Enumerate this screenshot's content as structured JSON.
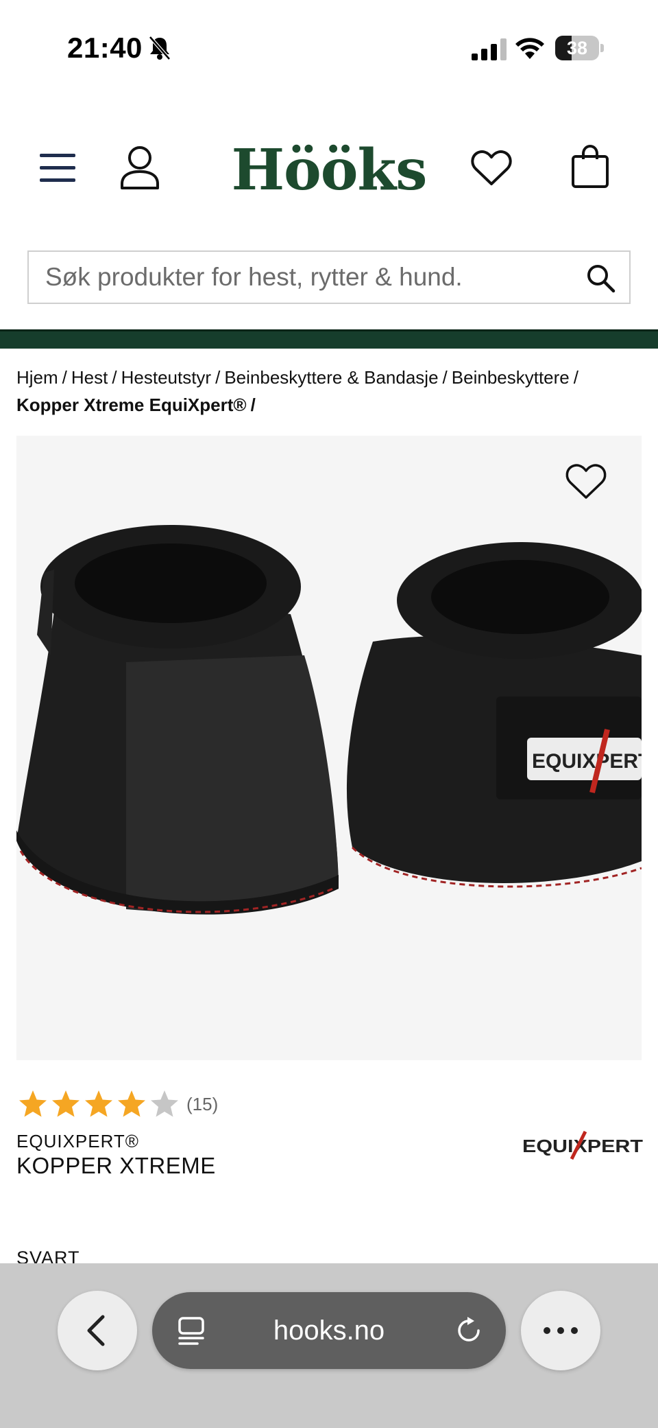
{
  "status_bar": {
    "time": "21:40",
    "battery": "38",
    "battery_level": 0.38
  },
  "header": {
    "logo": "Hööks",
    "brand_color": "#1d4a2e",
    "icons": [
      "menu-icon",
      "account-icon",
      "wishlist-icon",
      "cart-icon"
    ]
  },
  "search": {
    "placeholder": "Søk produkter for hest, rytter & hund."
  },
  "breadcrumb": {
    "items": [
      "Hjem",
      "Hest",
      "Hesteutstyr",
      "Beinbeskyttere & Bandasje",
      "Beinbeskyttere"
    ],
    "current": "Kopper Xtreme EquiXpert®",
    "separator": "/"
  },
  "product": {
    "image_alt": "Kopper Xtreme EquiXpert",
    "image_logo_text": "EQUIXPERT",
    "rating": 4,
    "rating_max": 5,
    "review_count": "(15)",
    "brand": "EQUIXPERT®",
    "name": "KOPPER XTREME",
    "brand_logo_text": "EQUIXPERT",
    "color_label": "SVART",
    "star_color": "#f5a623",
    "star_empty_color": "#c6c6c6"
  },
  "browser": {
    "url": "hooks.no",
    "icons": [
      "back-icon",
      "tabs-icon",
      "reload-icon",
      "more-icon"
    ]
  }
}
